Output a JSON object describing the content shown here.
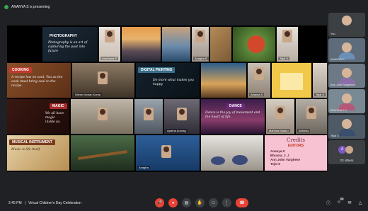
{
  "presenting": {
    "text": "ANANYA S is presenting"
  },
  "stage_tiles": {
    "photography": {
      "title": "PHOTOGRAPHY",
      "text": "Photography is an art of capturing the past into future"
    },
    "cooking": {
      "title": "COOKING",
      "text": "A recipe has no soul. You as the cook must bring soul to the recipe."
    },
    "digital_painting": {
      "title": "DIGITAL PAINTING",
      "text": "Do more what makes you happy"
    },
    "magic": {
      "title": "MAGIC",
      "text": "We all have magic inside us."
    },
    "dance": {
      "title": "DANCE",
      "text": "Dance is the joy of movement and the heart of life."
    },
    "musical_instrument": {
      "title": "MUSICAL INSTRUMENT",
      "text": "Music is life itself"
    },
    "credits": {
      "title": "Credits",
      "subtitle": "EDITORS",
      "names": [
        "Ananya.S",
        "Bhuvna. J. J",
        "Ann John Varghese",
        "Tejal S"
      ]
    },
    "names": {
      "n1": "Aradhana P",
      "n2": "Anagha S",
      "n3": "Tejal S",
      "n4": "Nilesh Mohan Kuma",
      "n5": "Ananya S",
      "n6": "Tejal S",
      "n7": "Aparna Anurag",
      "n8": "Mahima Madhu",
      "n9": "Abhinav",
      "n10": "Anagha",
      "n11": "Bhuvna JJ"
    }
  },
  "right_strip": {
    "you": "You",
    "p2": "ANANYA S",
    "p3": "Ann John Varghese",
    "p4": "BHUVNA J J",
    "p5": "Tejal S",
    "others": "23 others"
  },
  "bottom": {
    "time": "2:45 PM",
    "separator": "|",
    "meeting_name": "Virtual Children's Day Celebration",
    "people_count": "28"
  },
  "colors": {
    "background": "#202124",
    "end_call": "#ea4335",
    "present_dot": "#34a853"
  }
}
